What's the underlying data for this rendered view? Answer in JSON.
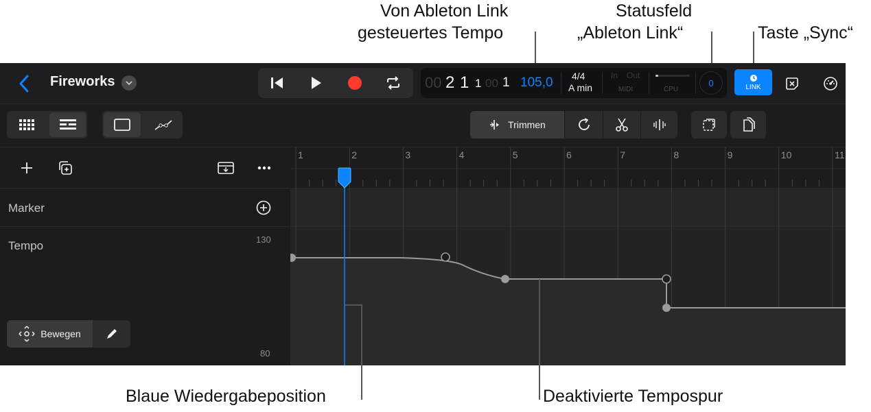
{
  "callouts": {
    "tempo_line1": "Von Ableton Link",
    "tempo_line2": "gesteuertes Tempo",
    "status_line1": "Statusfeld",
    "status_line2": "„Ableton Link“",
    "sync": "Taste „Sync“",
    "playhead": "Blaue Wiedergabeposition",
    "tempo_track": "Deaktivierte Tempospur"
  },
  "header": {
    "project_title": "Fireworks"
  },
  "lcd": {
    "position_dim1": "00",
    "position_bar": "2",
    "position_beat": "1",
    "position_div": "1",
    "position_dim2": "00",
    "position_tick": "1",
    "tempo": "105,0",
    "time_signature": "4/4",
    "key": "A min",
    "in_label": "In",
    "out_label": "Out",
    "midi_label": "MIDI",
    "cpu_label": "CPU",
    "link_peers": "0"
  },
  "buttons": {
    "link_label": "LINK",
    "trim_label": "Trimmen",
    "move_label": "Bewegen"
  },
  "tracks": {
    "marker": "Marker",
    "tempo": "Tempo",
    "tempo_max": "130",
    "tempo_min": "80"
  },
  "ruler": {
    "bars": [
      "1",
      "2",
      "3",
      "4",
      "5",
      "6",
      "7",
      "8",
      "9",
      "10",
      "11"
    ]
  },
  "colors": {
    "accent": "#0a84ff",
    "record": "#ff3b30",
    "background": "#1c1c1e"
  }
}
